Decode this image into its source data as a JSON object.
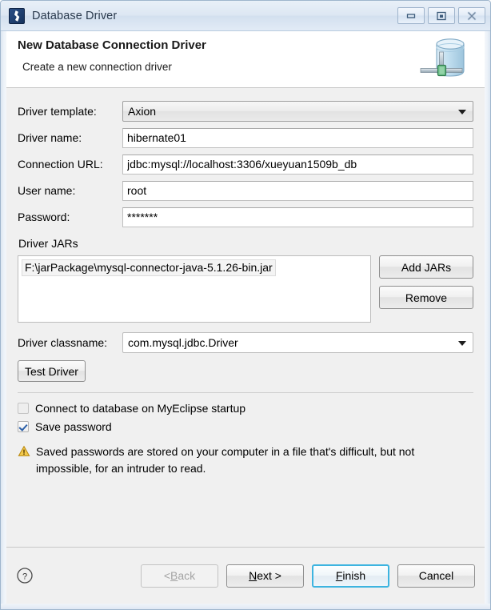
{
  "window": {
    "title": "Database Driver",
    "app_icon": "myeclipse-icon",
    "controls": {
      "minimize": "minimize-icon",
      "maximize": "maximize-icon",
      "close": "close-icon"
    }
  },
  "header": {
    "title": "New Database Connection Driver",
    "subtitle": "Create a new connection driver",
    "icon": "database-connection-icon"
  },
  "form": {
    "driver_template": {
      "label": "Driver template:",
      "value": "Axion"
    },
    "driver_name": {
      "label": "Driver name:",
      "value": "hibernate01",
      "placeholder": ""
    },
    "connection_url": {
      "label": "Connection URL:",
      "value": "jdbc:mysql://localhost:3306/xueyuan1509b_db",
      "placeholder": ""
    },
    "user_name": {
      "label": "User name:",
      "value": "root",
      "placeholder": ""
    },
    "password": {
      "label": "Password:",
      "value": "*******",
      "placeholder": ""
    }
  },
  "driver_jars": {
    "label": "Driver JARs",
    "items": [
      "F:\\jarPackage\\mysql-connector-java-5.1.26-bin.jar"
    ],
    "add_button": "Add JARs",
    "remove_button": "Remove"
  },
  "driver_classname": {
    "label": "Driver classname:",
    "value": "com.mysql.jdbc.Driver"
  },
  "test_driver_button": "Test Driver",
  "options": {
    "connect_on_startup": {
      "label": "Connect to database on MyEclipse startup",
      "checked": false
    },
    "save_password": {
      "label": "Save password",
      "checked": true
    }
  },
  "warning": {
    "icon": "warning-icon",
    "text": "Saved passwords are stored on your computer in a file that's difficult, but not impossible, for an intruder to read."
  },
  "footer": {
    "help_icon": "help-icon",
    "back": {
      "prefix": "< ",
      "mnemonic": "B",
      "suffix": "ack",
      "enabled": false
    },
    "next": {
      "prefix": "",
      "mnemonic": "N",
      "suffix": "ext >",
      "enabled": true
    },
    "finish": {
      "prefix": "",
      "mnemonic": "F",
      "suffix": "inish",
      "enabled": true
    },
    "cancel": {
      "prefix": "",
      "mnemonic": "",
      "suffix": "Cancel",
      "enabled": true
    }
  },
  "colors": {
    "titlebar": "#dde7f3",
    "dialog_bg": "#f0f0f0",
    "header_bg": "#ffffff",
    "default_button_border": "#3db4e0",
    "warning": "#e8a317",
    "checkbox_check": "#2b5fa8"
  }
}
